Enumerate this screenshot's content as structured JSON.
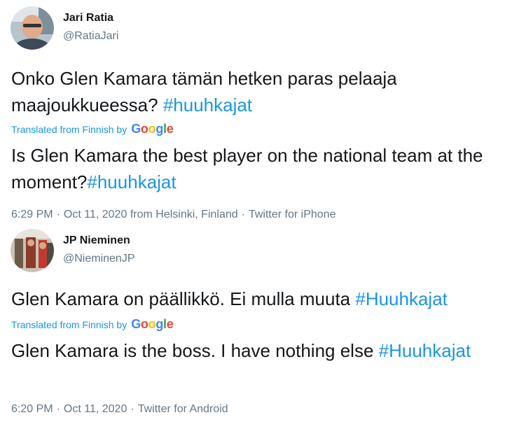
{
  "tweets": [
    {
      "name": "Jari Ratia",
      "handle": "@RatiaJari",
      "avatar_icon": "user-avatar-photo",
      "original_text": "Onko Glen Kamara tämän hetken paras pelaaja maajoukkueessa? ",
      "original_hashtag": "#huuhkajat",
      "translated_label": "Translated from Finnish by",
      "translator": "Google",
      "translated_text": "Is Glen Kamara the best player on the national team at the moment?",
      "translated_hashtag": "#huuhkajat",
      "time": "6:29 PM",
      "date": "Oct 11, 2020",
      "location": "from Helsinki, Finland",
      "source": "Twitter for iPhone"
    },
    {
      "name": "JP Nieminen",
      "handle": "@NieminenJP",
      "avatar_icon": "user-avatar-photo",
      "original_text": "Glen Kamara on päällikkö. Ei mulla muuta ",
      "original_hashtag": "#Huuhkajat",
      "translated_label": "Translated from Finnish by",
      "translator": "Google",
      "translated_text": "Glen Kamara is the boss. I have nothing else ",
      "translated_hashtag": "#Huuhkajat",
      "time": "6:20 PM",
      "date": "Oct 11, 2020",
      "source": "Twitter for Android"
    }
  ],
  "separator": "·",
  "colors": {
    "text": "#14171a",
    "secondary": "#657786",
    "link": "#1b95e0"
  }
}
